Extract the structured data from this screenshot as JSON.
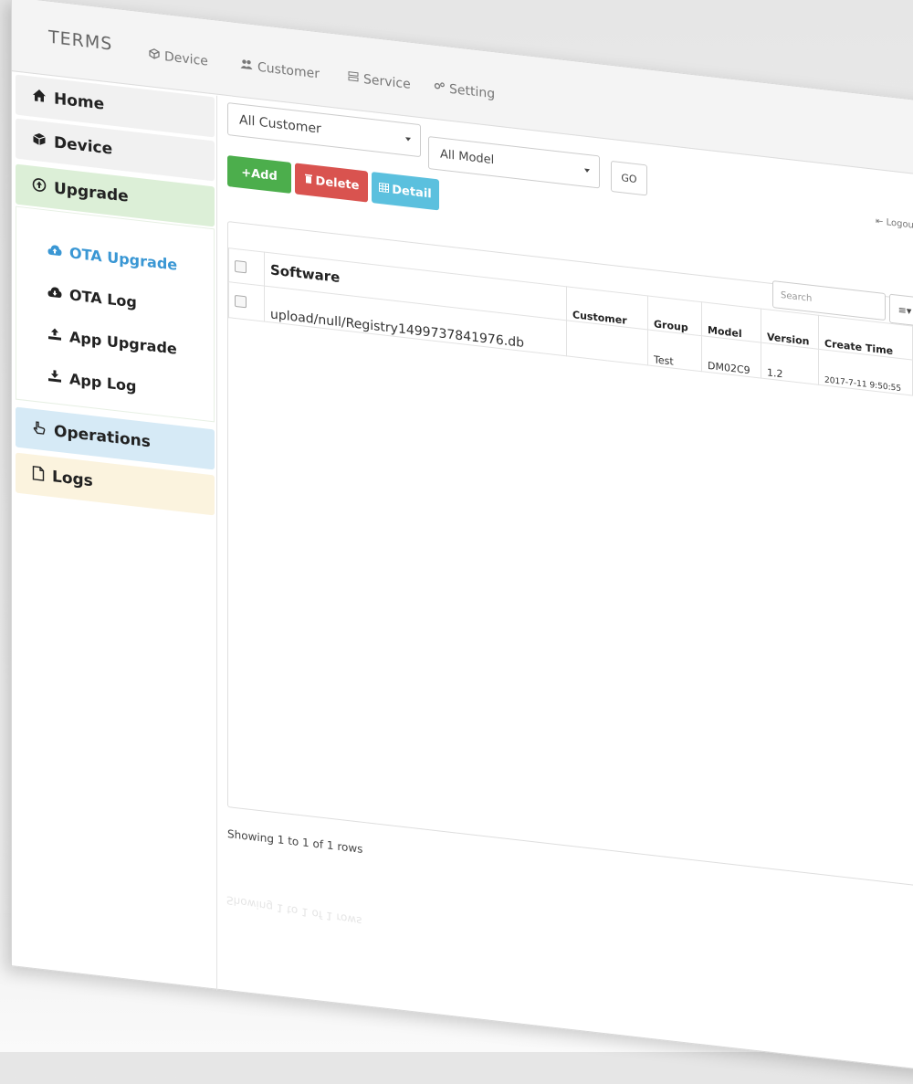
{
  "topnav": {
    "brand": "TERMS",
    "items": [
      {
        "label": "Device",
        "icon": "cube-icon"
      },
      {
        "label": "Customer",
        "icon": "users-icon"
      },
      {
        "label": "Service",
        "icon": "server-icon"
      },
      {
        "label": "Setting",
        "icon": "gears-icon"
      }
    ],
    "logout": "Logout"
  },
  "sidebar": {
    "home": "Home",
    "device": "Device",
    "upgrade": "Upgrade",
    "sub_items": [
      {
        "label": "OTA Upgrade",
        "icon": "cloud-upload-icon",
        "active": true
      },
      {
        "label": "OTA Log",
        "icon": "cloud-download-icon",
        "active": false
      },
      {
        "label": "App Upgrade",
        "icon": "upload-icon",
        "active": false
      },
      {
        "label": "App Log",
        "icon": "download-icon",
        "active": false
      }
    ],
    "operations": "Operations",
    "logs": "Logs",
    "colors": {
      "upgrade_bg": "#dcefd7",
      "operations_bg": "#d6eaf6",
      "logs_bg": "#fbf3de",
      "active_text": "#3a97d4"
    }
  },
  "filters": {
    "customer": "All Customer",
    "model": "All Model",
    "go": "GO"
  },
  "actions": {
    "add": "+Add",
    "delete": "Delete",
    "detail": "Detail",
    "colors": {
      "add": "#4cae4c",
      "delete": "#d9534f",
      "detail": "#5bc0de"
    }
  },
  "table": {
    "search_placeholder": "Search",
    "columns_button": "≡▾",
    "headers": [
      "Software",
      "Customer",
      "Group",
      "Model",
      "Version",
      "Create Time"
    ],
    "rows": [
      {
        "software": "upload/null/Registry1499737841976.db",
        "customer": "",
        "group": "Test",
        "model": "DM02C9",
        "version": "1.2",
        "create_time": "2017-7-11 9:50:55"
      }
    ],
    "footer": "Showing 1 to 1 of 1 rows"
  }
}
